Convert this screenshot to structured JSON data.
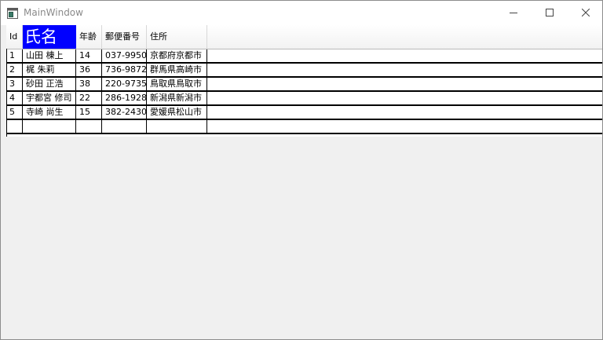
{
  "window": {
    "title": "MainWindow"
  },
  "colors": {
    "selected_header_bg": "#0000ff",
    "selected_header_text": "#ffffff",
    "grid_line": "#000000",
    "window_bg": "#f0f0f0"
  },
  "icons": {
    "app": "app-window-icon",
    "minimize": "minimize-icon",
    "maximize": "maximize-icon",
    "close": "close-icon"
  },
  "grid": {
    "headers": [
      "Id",
      "氏名",
      "年齢",
      "郵便番号",
      "住所"
    ],
    "selected_header": "氏名",
    "rows": [
      [
        "1",
        "山田 棟上",
        "14",
        "037-9950",
        "京都府京都市"
      ],
      [
        "2",
        "梶 朱莉",
        "36",
        "736-9872",
        "群馬県高崎市"
      ],
      [
        "3",
        "砂田 正浩",
        "38",
        "220-9735",
        "鳥取県鳥取市"
      ],
      [
        "4",
        "宇都宮 修司",
        "22",
        "286-1928",
        "新潟県新潟市"
      ],
      [
        "5",
        "寺崎 尚生",
        "15",
        "382-2430",
        "愛媛県松山市"
      ],
      [
        "",
        "",
        "",
        "",
        ""
      ]
    ]
  }
}
